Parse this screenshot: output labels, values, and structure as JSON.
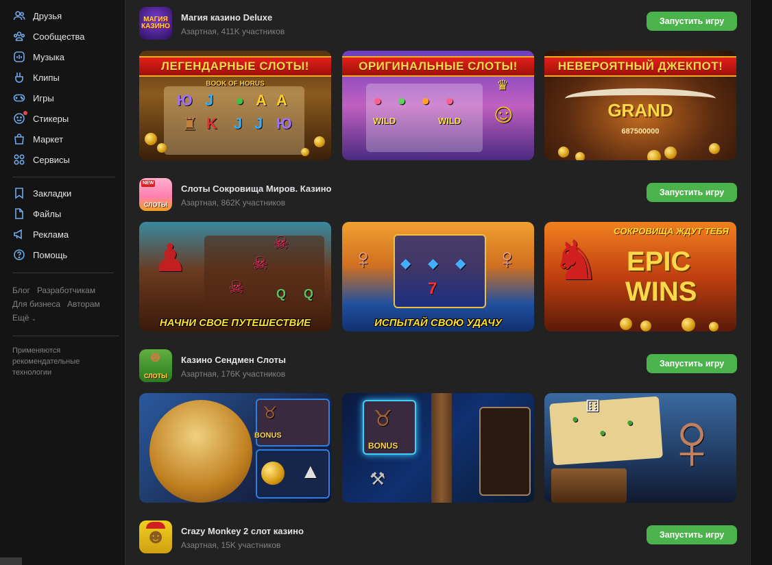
{
  "sidebar": {
    "items": [
      {
        "label": "Друзья",
        "icon": "friends-icon"
      },
      {
        "label": "Сообщества",
        "icon": "communities-icon"
      },
      {
        "label": "Музыка",
        "icon": "music-icon"
      },
      {
        "label": "Клипы",
        "icon": "clips-icon"
      },
      {
        "label": "Игры",
        "icon": "games-icon"
      },
      {
        "label": "Стикеры",
        "icon": "stickers-icon"
      },
      {
        "label": "Маркет",
        "icon": "market-icon"
      },
      {
        "label": "Сервисы",
        "icon": "services-icon"
      }
    ],
    "items2": [
      {
        "label": "Закладки",
        "icon": "bookmark-icon"
      },
      {
        "label": "Файлы",
        "icon": "file-icon"
      },
      {
        "label": "Реклама",
        "icon": "megaphone-icon"
      },
      {
        "label": "Помощь",
        "icon": "help-icon"
      }
    ],
    "footer": {
      "blog": "Блог",
      "developers": "Разработчикам",
      "business": "Для бизнеса",
      "authors": "Авторам",
      "more": "Ещё"
    },
    "rec_note": "Применяются рекомендательные технологии"
  },
  "play_label": "Запустить игру",
  "games": [
    {
      "title": "Магия казино Deluxe",
      "meta": "Азартная, 411K участников",
      "avatar_text": "МАГИЯ КАЗИНО",
      "shots": [
        {
          "banner": "ЛЕГЕНДАРНЫЕ СЛОТЫ!",
          "book": "BOOK OF HORUS"
        },
        {
          "banner": "ОРИГИНАЛЬНЫЕ СЛОТЫ!"
        },
        {
          "banner": "НЕВЕРОЯТНЫЙ ДЖЕКПОТ!",
          "big": "GRAND",
          "sub": "687500000"
        }
      ]
    },
    {
      "title": "Слоты Сокровища Миров. Казино",
      "meta": "Азартная, 862K участников",
      "avatar_text": "СЛОТЫ",
      "avatar_badge": "NEW",
      "shots": [
        {
          "caption": "НАЧНИ СВОЕ ПУТЕШЕСТВИЕ"
        },
        {
          "caption": "ИСПЫТАЙ СВОЮ УДАЧУ"
        },
        {
          "top": "СОКРОВИЩА ЖДУТ ТЕБЯ",
          "big1": "EPIC",
          "big2": "WINS"
        }
      ]
    },
    {
      "title": "Казино Сендмен Слоты",
      "meta": "Азартная, 176K участников",
      "avatar_text": "СЛОТЫ",
      "shots": [
        {
          "bonus": "BONUS"
        },
        {
          "bonus": "BONUS"
        },
        {}
      ]
    },
    {
      "title": "Crazy Monkey 2 слот казино",
      "meta": "Азартная, 15K участников"
    }
  ],
  "colors": {
    "accent_green": "#4bb34b",
    "nav_icon": "#71aaeb",
    "panel_bg": "#222222",
    "page_bg": "#141414"
  }
}
